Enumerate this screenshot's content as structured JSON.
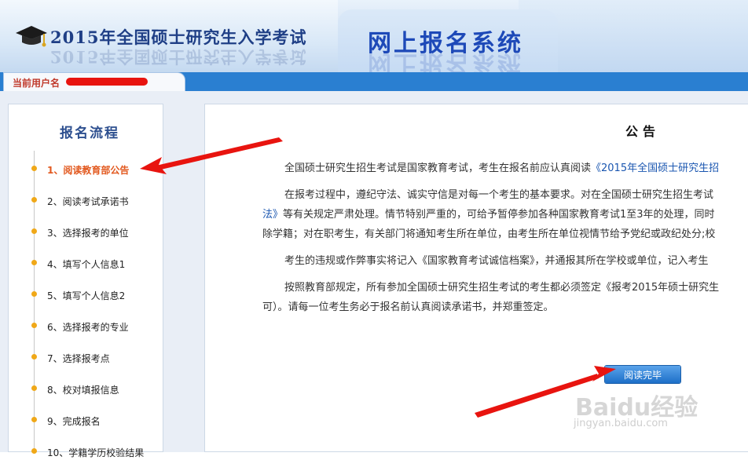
{
  "header": {
    "exam_title": "2015年全国硕士研究生入学考试",
    "system_title": "网上报名系统"
  },
  "userbar": {
    "label": "当前用户名"
  },
  "sidebar": {
    "title": "报名流程",
    "steps": [
      {
        "label": "1、阅读教育部公告",
        "active": true
      },
      {
        "label": "2、阅读考试承诺书"
      },
      {
        "label": "3、选择报考的单位"
      },
      {
        "label": "4、填写个人信息1"
      },
      {
        "label": "5、填写个人信息2"
      },
      {
        "label": "6、选择报考的专业"
      },
      {
        "label": "7、选择报考点"
      },
      {
        "label": "8、校对填报信息"
      },
      {
        "label": "9、完成报名"
      },
      {
        "label": "10、学籍学历校验结果"
      }
    ]
  },
  "notice": {
    "title": "公告",
    "p1_text": "全国硕士研究生招生考试是国家教育考试，考生在报名前应认真阅读",
    "p1_link": "《2015年全国硕士研究生招",
    "p2_line1": "在报考过程中，遵纪守法、诚实守信是对每一个考生的基本要求。对在全国硕士研究生招生考试",
    "p2_line2_link": "法》",
    "p2_line2_text": "等有关规定严肃处理。情节特别严重的，可给予暂停参加各种国家教育考试1至3年的处理，同时",
    "p2_line3": "除学籍；对在职考生，有关部门将通知考生所在单位，由考生所在单位视情节给予党纪或政纪处分;校",
    "p3": "考生的违规或作弊事实将记入《国家教育考试诚信档案》，并通报其所在学校或单位，记入考生",
    "p4_line1": "按照教育部规定，所有参加全国硕士研究生招生考试的考生都必须签定《报考2015年硕士研究生",
    "p4_line2": "可）。请每一位考生务必于报名前认真阅读承诺书，并郑重签定。"
  },
  "button": {
    "read_done": "阅读完毕"
  },
  "watermark": {
    "logo": "Baidu经验",
    "url": "jingyan.baidu.com"
  },
  "colors": {
    "accent_blue": "#2a7fd1",
    "active_step": "#e2591f",
    "dot": "#f0a818",
    "annotation_arrow": "#e8140f"
  }
}
